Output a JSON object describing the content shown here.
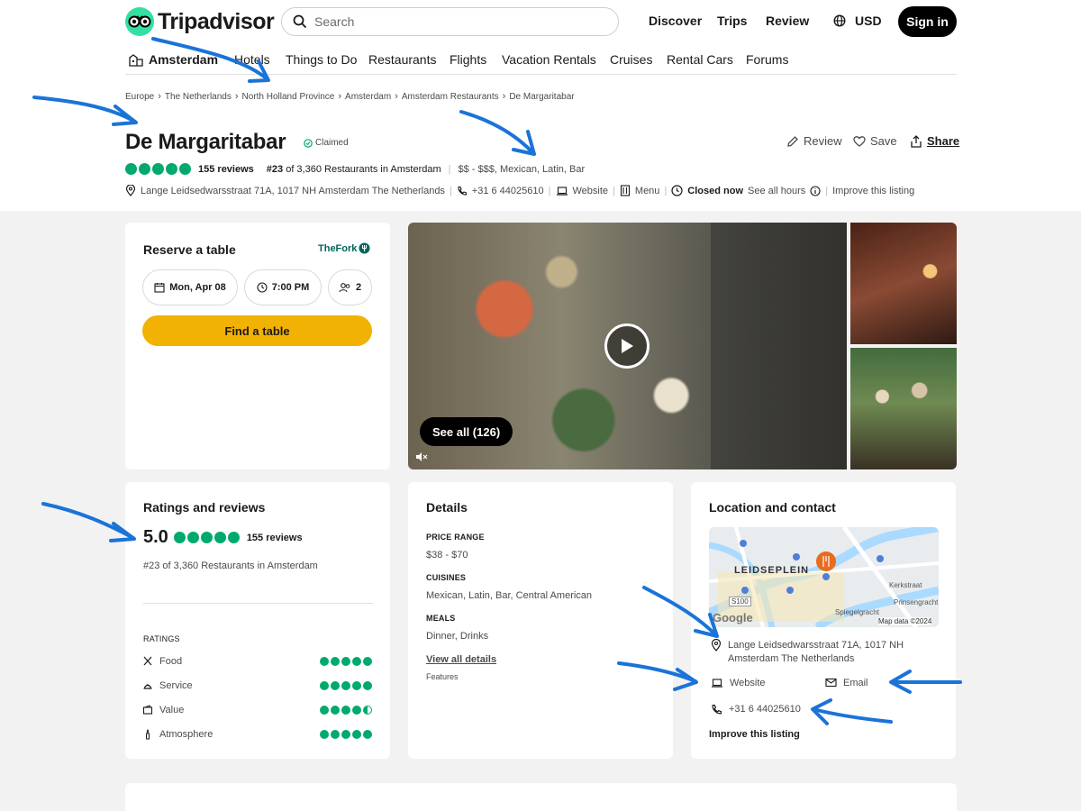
{
  "header": {
    "logo_text": "Tripadvisor",
    "search_placeholder": "Search",
    "nav": [
      "Discover",
      "Trips",
      "Review"
    ],
    "currency": "USD",
    "sign_in": "Sign in",
    "location": "Amsterdam",
    "categories": [
      "Hotels",
      "Things to Do",
      "Restaurants",
      "Flights",
      "Vacation Rentals",
      "Cruises",
      "Rental Cars",
      "Forums"
    ]
  },
  "breadcrumbs": [
    "Europe",
    "The Netherlands",
    "North Holland Province",
    "Amsterdam",
    "Amsterdam Restaurants",
    "De Margaritabar"
  ],
  "restaurant": {
    "name": "De Margaritabar",
    "claimed": "Claimed",
    "reviews": "155 reviews",
    "rank_num": "#23",
    "rank_text": "of 3,360 Restaurants in Amsterdam",
    "price_cuisine": "$$ - $$$, Mexican, Latin, Bar",
    "address": "Lange Leidsedwarsstraat 71A, 1017 NH Amsterdam The Netherlands",
    "phone": "+31 6 44025610",
    "website": "Website",
    "menu": "Menu",
    "status": "Closed now",
    "hours": "See all hours",
    "improve": "Improve this listing",
    "rating_bubbles": 5
  },
  "actions": {
    "review": "Review",
    "save": "Save",
    "share": "Share"
  },
  "reserve": {
    "title": "Reserve a table",
    "partner": "TheFork",
    "date": "Mon, Apr 08",
    "time": "7:00 PM",
    "party": "2",
    "button": "Find a table"
  },
  "gallery": {
    "see_all": "See all (126)"
  },
  "ratings": {
    "title": "Ratings and reviews",
    "score": "5.0",
    "reviews": "155 reviews",
    "rank_num": "#23",
    "rank_text": "of 3,360 Restaurants in Amsterdam",
    "label": "RATINGS",
    "items": [
      {
        "name": "Food",
        "value": 5
      },
      {
        "name": "Service",
        "value": 5
      },
      {
        "name": "Value",
        "value": 4.5
      },
      {
        "name": "Atmosphere",
        "value": 5
      }
    ]
  },
  "details": {
    "title": "Details",
    "price_label": "PRICE RANGE",
    "price": "$38 - $70",
    "cuisines_label": "CUISINES",
    "cuisines": "Mexican, Latin, Bar, Central American",
    "meals_label": "MEALS",
    "meals": "Dinner, Drinks",
    "view_all": "View all details",
    "features": "Features"
  },
  "location": {
    "title": "Location and contact",
    "map_label": "LEIDSEPLEIN",
    "map_street1": "Kerkstraat",
    "map_street2": "Prinsengracht",
    "map_street3": "Spiegelgracht",
    "map_route": "S100",
    "map_brand": "Google",
    "map_copyright": "Map data ©2024",
    "address_line1": "Lange Leidsedwarsstraat 71A, 1017 NH",
    "address_line2": "Amsterdam The Netherlands",
    "website": "Website",
    "email": "Email",
    "phone": "+31 6 44025610",
    "improve": "Improve this listing"
  },
  "colors": {
    "brand_green": "#34e0a1",
    "bubble_green": "#00aa6c",
    "fork_green": "#00665c",
    "button_yellow": "#f2b203",
    "annotation_blue": "#1a73d8"
  }
}
